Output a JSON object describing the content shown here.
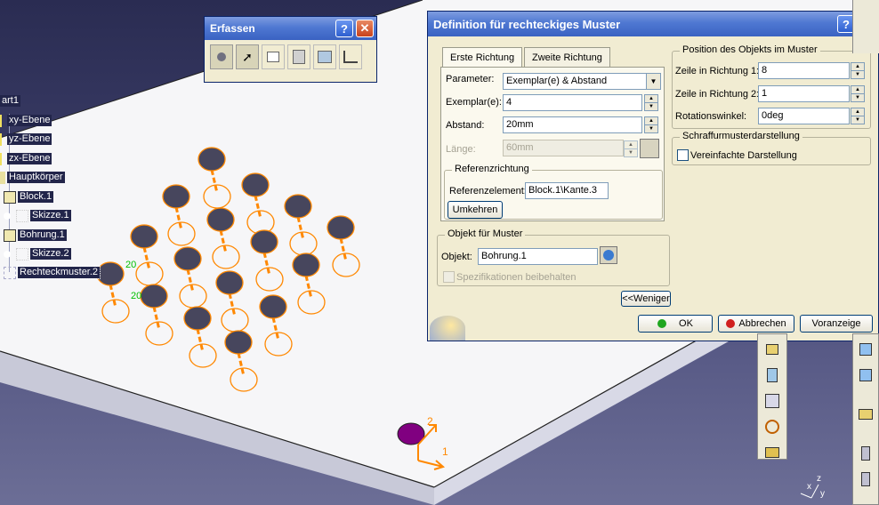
{
  "tree": {
    "items": [
      {
        "label": "art1"
      },
      {
        "label": "xy-Ebene"
      },
      {
        "label": "yz-Ebene"
      },
      {
        "label": "zx-Ebene"
      },
      {
        "label": "Hauptkörper"
      },
      {
        "label": "Block.1"
      },
      {
        "label": "Skizze.1"
      },
      {
        "label": "Bohrung.1"
      },
      {
        "label": "Skizze.2"
      },
      {
        "label": "Rechteckmuster.2"
      }
    ]
  },
  "annotations": {
    "dim1": "20",
    "dim2": "20",
    "axis1": "1",
    "axis2": "2"
  },
  "triad": {
    "z": "z",
    "y": "y",
    "x": "x"
  },
  "erfassen": {
    "title": "Erfassen",
    "help": "?",
    "close": "✕"
  },
  "dialog": {
    "title": "Definition für rechteckiges Muster",
    "help": "?",
    "close": "✕",
    "tabs": [
      "Erste Richtung",
      "Zweite Richtung"
    ],
    "parameter_label": "Parameter:",
    "parameter_value": "Exemplar(e) & Abstand",
    "exemplare_label": "Exemplar(e):",
    "exemplare_value": "4",
    "abstand_label": "Abstand:",
    "abstand_value": "20mm",
    "laenge_label": "Länge:",
    "laenge_value": "60mm",
    "referenzrichtung": {
      "title": "Referenzrichtung",
      "element_label": "Referenzelement:",
      "element_value": "Block.1\\Kante.3",
      "umkehren": "Umkehren"
    },
    "objekt_group": {
      "title": "Objekt für Muster",
      "objekt_label": "Objekt:",
      "objekt_value": "Bohrung.1",
      "spezifikationen": "Spezifikationen beibehalten"
    },
    "weniger": "<<Weniger",
    "position": {
      "title": "Position des Objekts im Muster",
      "zeile1_label": "Zeile in Richtung 1:",
      "zeile1_value": "8",
      "zeile2_label": "Zeile in Richtung 2:",
      "zeile2_value": "1",
      "rotation_label": "Rotationswinkel:",
      "rotation_value": "0deg"
    },
    "schraffur": {
      "title": "Schraffurmusterdarstellung",
      "vereinfacht": "Vereinfachte Darstellung"
    },
    "ok": "OK",
    "abbrechen": "Abbrechen",
    "voranzeige": "Voranzeige"
  },
  "colors": {
    "background": "#3a3c66",
    "hole": "#47465d",
    "pattern": "#ff8800",
    "selected_hole": "#800080",
    "title_bar": "#3a62c2"
  }
}
